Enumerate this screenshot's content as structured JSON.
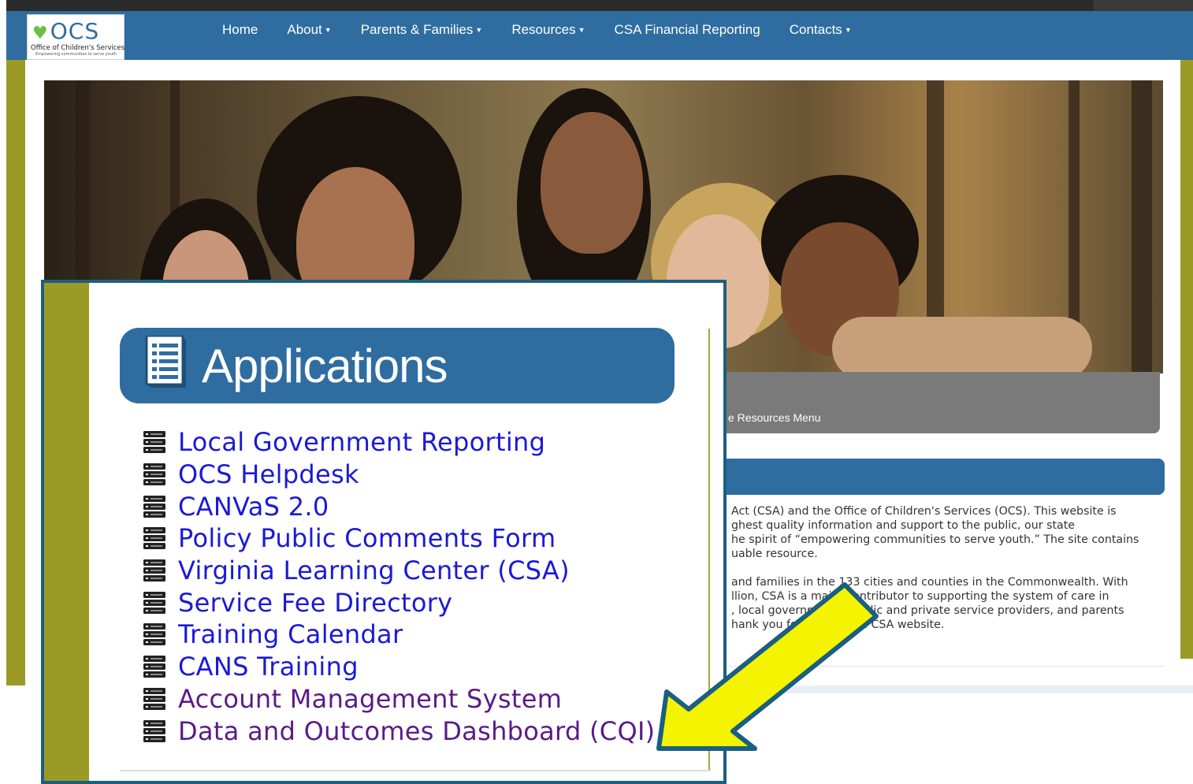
{
  "site": {
    "logo_text": "OCS",
    "logo_name": "Office of Children's Services",
    "logo_tagline": "Empowering communities to serve youth"
  },
  "nav": {
    "items": [
      {
        "label": "Home",
        "dropdown": false
      },
      {
        "label": "About",
        "dropdown": true
      },
      {
        "label": "Parents & Families",
        "dropdown": true
      },
      {
        "label": "Resources",
        "dropdown": true
      },
      {
        "label": "CSA Financial Reporting",
        "dropdown": false
      },
      {
        "label": "Contacts",
        "dropdown": true
      }
    ]
  },
  "resources_bar": {
    "text": "e Resources Menu"
  },
  "intro": {
    "p1_lines": [
      "Act (CSA) and the Office of Children's Services (OCS). This website is",
      "ghest quality information and support to the public, our state",
      "he spirit of “empowering communities to serve youth.” The site contains",
      "uable resource."
    ],
    "p2_lines": [
      "and families in the 133 cities and counties in the Commonwealth. With",
      "llion, CSA is a major contributor to supporting the system of care in",
      ", local governments, public and private service providers, and parents",
      "hank you for visiting the CSA website."
    ]
  },
  "applications": {
    "title": "Applications",
    "items": [
      "Local Government Reporting",
      "OCS Helpdesk",
      "CANVaS 2.0",
      "Policy Public Comments Form",
      "Virginia Learning Center (CSA)",
      "Service Fee Directory",
      "Training Calendar",
      "CANS Training",
      "Account Management System",
      "Data and Outcomes Dashboard (CQI)"
    ]
  },
  "colors": {
    "nav_blue": "#2f6da0",
    "olive": "#9c9a26",
    "link_blue": "#1a1ad6",
    "link_visited": "#5b1a8a",
    "arrow_yellow": "#f4f400",
    "arrow_outline": "#1b5f80"
  }
}
